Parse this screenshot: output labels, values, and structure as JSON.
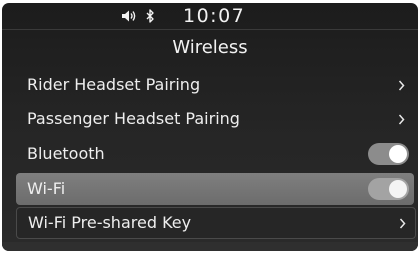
{
  "status_bar": {
    "time": "10:07",
    "icons": [
      "speaker-volume-icon",
      "bluetooth-icon"
    ]
  },
  "screen": {
    "title": "Wireless"
  },
  "menu": {
    "items": [
      {
        "label": "Rider Headset Pairing",
        "control": "chevron"
      },
      {
        "label": "Passenger Headset Pairing",
        "control": "chevron"
      },
      {
        "label": "Bluetooth",
        "control": "toggle",
        "toggle_state": "on"
      },
      {
        "label": "Wi-Fi",
        "control": "toggle",
        "toggle_state": "on",
        "selected": true
      },
      {
        "label": "Wi-Fi Pre-shared Key",
        "control": "chevron"
      }
    ]
  }
}
